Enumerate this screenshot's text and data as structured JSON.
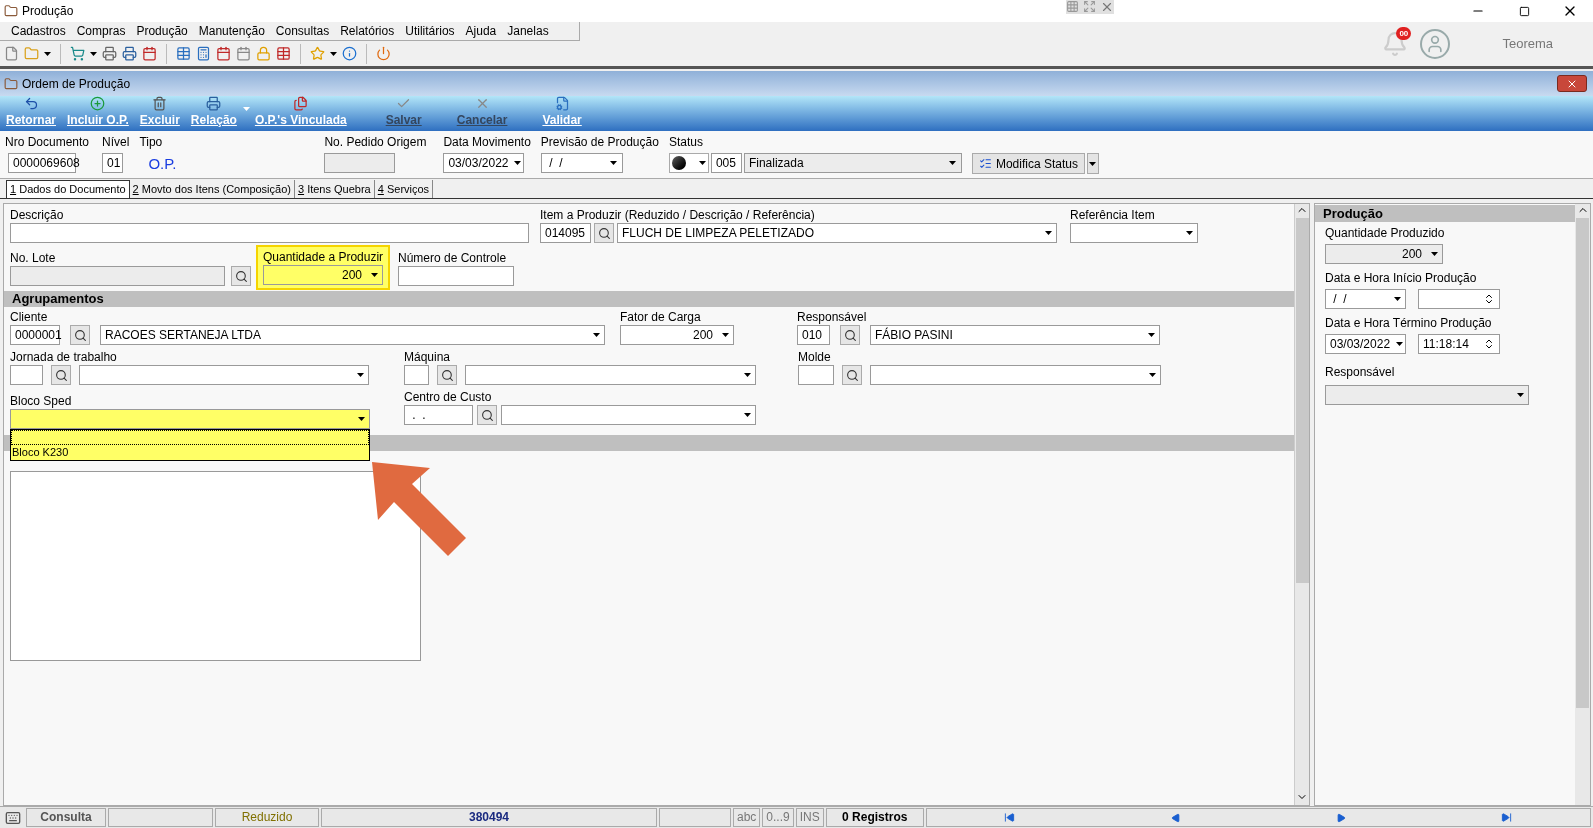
{
  "window": {
    "title": "Produção"
  },
  "menu": [
    "Cadastros",
    "Compras",
    "Produção",
    "Manutenção",
    "Consultas",
    "Relatórios",
    "Utilitários",
    "Ajuda",
    "Janelas"
  ],
  "notifications": {
    "count": "00"
  },
  "user": {
    "name": "Teorema"
  },
  "form": {
    "title": "Ordem de Produção",
    "actions": [
      {
        "label": "Retornar",
        "disabled": false,
        "menu": false
      },
      {
        "label": "Incluir O.P.",
        "disabled": false,
        "menu": false
      },
      {
        "label": "Excluir",
        "disabled": false,
        "menu": false
      },
      {
        "label": "Relação",
        "disabled": false,
        "menu": true
      },
      {
        "label": "O.P.'s Vinculada",
        "disabled": false,
        "menu": false
      },
      {
        "label": "Salvar",
        "disabled": true,
        "menu": false
      },
      {
        "label": "Cancelar",
        "disabled": true,
        "menu": false
      },
      {
        "label": "Validar",
        "disabled": false,
        "menu": false
      }
    ],
    "header": {
      "nro_documento": {
        "label": "Nro Documento",
        "value": "0000069608"
      },
      "nivel": {
        "label": "Nível",
        "value": "01"
      },
      "tipo": {
        "label": "Tipo",
        "value": "O.P."
      },
      "pedido_origem": {
        "label": "No. Pedido Origem",
        "disabled": true
      },
      "data_movimento": {
        "label": "Data Movimento",
        "value": "03/03/2022"
      },
      "previsao": {
        "label": "Previsão de Produção",
        "value": " /  /"
      },
      "status": {
        "label": "Status",
        "code": "005",
        "value": "Finalizada"
      },
      "modifica_status": "Modifica Status"
    },
    "tabs": [
      {
        "number": "1",
        "label": "Dados do Documento",
        "selected": true
      },
      {
        "number": "2",
        "label": "Movto dos Itens (Composição)",
        "selected": false
      },
      {
        "number": "3",
        "label": "Itens Quebra",
        "selected": false
      },
      {
        "number": "4",
        "label": "Serviços",
        "selected": false
      }
    ],
    "main": {
      "descricao": {
        "label": "Descrição"
      },
      "item": {
        "label": "Item a Produzir (Reduzido / Descrição / Referência)",
        "code": "014095",
        "value": "FLUCH DE LIMPEZA PELETIZADO"
      },
      "referencia": {
        "label": "Referência Item"
      },
      "lote": {
        "label": "No. Lote",
        "disabled": true
      },
      "quantidade": {
        "label": "Quantidade a Produzir",
        "value": "200",
        "highlighted": true
      },
      "controle": {
        "label": "Número de Controle"
      },
      "section": "Agrupamentos",
      "cliente": {
        "label": "Cliente",
        "code": "0000001",
        "value": "RACOES SERTANEJA LTDA"
      },
      "fator": {
        "label": "Fator de Carga",
        "value": "200"
      },
      "responsavel": {
        "label": "Responsável",
        "code": "010",
        "value": "FÁBIO PASINI"
      },
      "jornada": {
        "label": "Jornada de trabalho"
      },
      "maquina": {
        "label": "Máquina"
      },
      "molde": {
        "label": "Molde"
      },
      "bloco": {
        "label": "Bloco Sped",
        "highlighted": true,
        "expanded": true,
        "options": [
          {
            "label": "Bloco K230",
            "selected": false
          }
        ]
      },
      "centro": {
        "label": "Centro de Custo",
        "code": " .  ."
      }
    },
    "producao": {
      "title": "Produção",
      "quantidade": {
        "label": "Quantidade Produzido",
        "value": "200"
      },
      "inicio": {
        "label": "Data e Hora Início Produção",
        "date": " /  /"
      },
      "termino": {
        "label": "Data e Hora Término Produção",
        "date": "03/03/2022",
        "time": "11:18:14"
      },
      "responsavel": {
        "label": "Responsável"
      }
    }
  },
  "status_bar": [
    {
      "kind": "mode",
      "text": "Consulta"
    },
    {
      "kind": "empty"
    },
    {
      "kind": "view",
      "text": "Reduzido"
    },
    {
      "kind": "record",
      "text": "380494"
    },
    {
      "kind": "empty"
    },
    {
      "kind": "flag",
      "text": "abc"
    },
    {
      "kind": "flag",
      "text": "0...9"
    },
    {
      "kind": "flag",
      "text": "INS"
    },
    {
      "kind": "count",
      "text": "0 Registros"
    }
  ]
}
